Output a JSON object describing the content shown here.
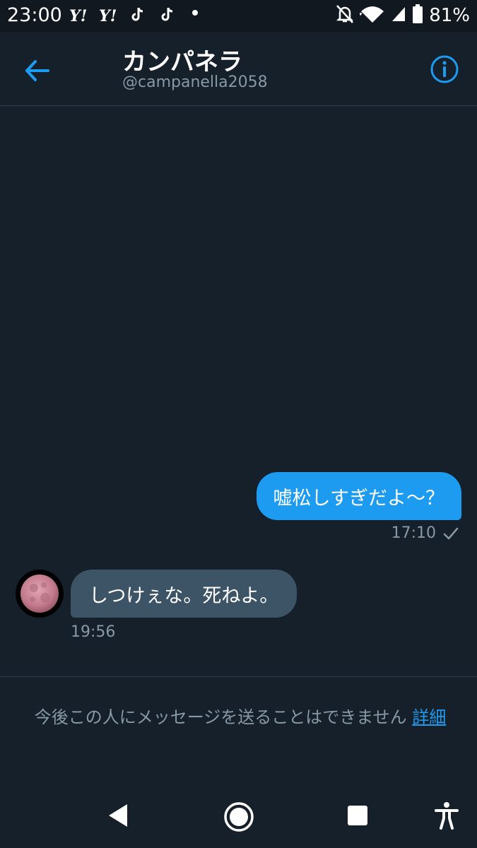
{
  "status_bar": {
    "time": "23:00",
    "notifications": [
      "Y!",
      "Y!"
    ],
    "battery_pct": "81%",
    "icons": [
      "yahoo-icon",
      "tiktok-icon",
      "mute-bell-icon",
      "wifi-icon",
      "signal-icon",
      "battery-icon"
    ]
  },
  "header": {
    "title": "カンパネラ",
    "handle": "@campanella2058"
  },
  "messages": {
    "sent": {
      "text": "嘘松しすぎだよ～？",
      "time": "17:10"
    },
    "received": {
      "text": "しつけぇな。死ねよ。",
      "time": "19:56"
    }
  },
  "footer": {
    "notice": "今後この人にメッセージを送ることはできません",
    "link": "詳細"
  },
  "colors": {
    "background": "#15202b",
    "accent": "#1d9bf0",
    "received_bubble": "#3d5466",
    "muted_text": "#8899a6"
  }
}
